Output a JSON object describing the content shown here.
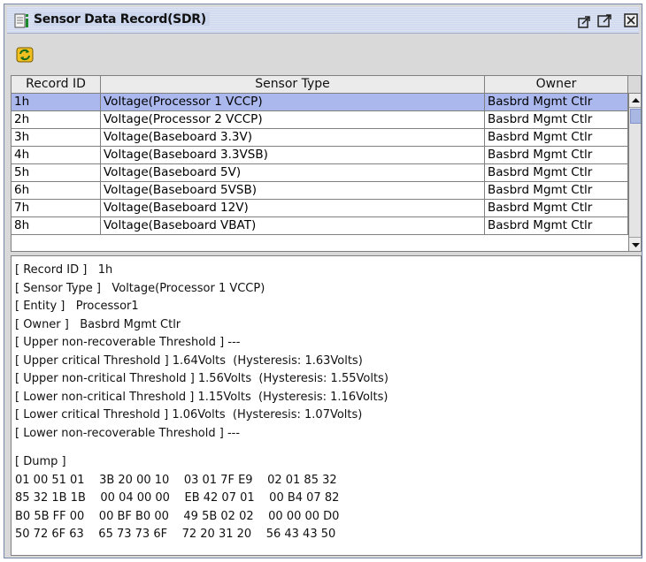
{
  "window": {
    "title": "Sensor Data Record(SDR)",
    "accent": "#ccd6ec",
    "selection_color": "#aab8ee"
  },
  "toolbar": {
    "refresh_icon": "refresh-icon"
  },
  "table": {
    "columns": [
      "Record ID",
      "Sensor Type",
      "Owner"
    ],
    "rows": [
      [
        "1h",
        "Voltage(Processor 1 VCCP)",
        "Basbrd Mgmt Ctlr"
      ],
      [
        "2h",
        "Voltage(Processor 2 VCCP)",
        "Basbrd Mgmt Ctlr"
      ],
      [
        "3h",
        "Voltage(Baseboard 3.3V)",
        "Basbrd Mgmt Ctlr"
      ],
      [
        "4h",
        "Voltage(Baseboard 3.3VSB)",
        "Basbrd Mgmt Ctlr"
      ],
      [
        "5h",
        "Voltage(Baseboard 5V)",
        "Basbrd Mgmt Ctlr"
      ],
      [
        "6h",
        "Voltage(Baseboard 5VSB)",
        "Basbrd Mgmt Ctlr"
      ],
      [
        "7h",
        "Voltage(Baseboard 12V)",
        "Basbrd Mgmt Ctlr"
      ],
      [
        "8h",
        "Voltage(Baseboard VBAT)",
        "Basbrd Mgmt Ctlr"
      ]
    ],
    "selected_index": 0
  },
  "detail": {
    "lines": [
      "[ Record ID ]   1h",
      "[ Sensor Type ]   Voltage(Processor 1 VCCP)",
      "[ Entity ]   Processor1",
      "[ Owner ]   Basbrd Mgmt Ctlr",
      "[ Upper non-recoverable Threshold ] ---",
      "[ Upper critical Threshold ] 1.64Volts  (Hysteresis: 1.63Volts)",
      "[ Upper non-critical Threshold ] 1.56Volts  (Hysteresis: 1.55Volts)",
      "[ Lower non-critical Threshold ] 1.15Volts  (Hysteresis: 1.16Volts)",
      "[ Lower critical Threshold ] 1.06Volts  (Hysteresis: 1.07Volts)",
      "[ Lower non-recoverable Threshold ] ---"
    ],
    "dump_label": "[ Dump ]",
    "dump_lines": [
      "01 00 51 01    3B 20 00 10    03 01 7F E9    02 01 85 32",
      "85 32 1B 1B    00 04 00 00    EB 42 07 01    00 B4 07 82",
      "B0 5B FF 00    00 BF B0 00    49 5B 02 02    00 00 00 D0",
      "50 72 6F 63    65 73 73 6F    72 20 31 20    56 43 43 50"
    ]
  }
}
